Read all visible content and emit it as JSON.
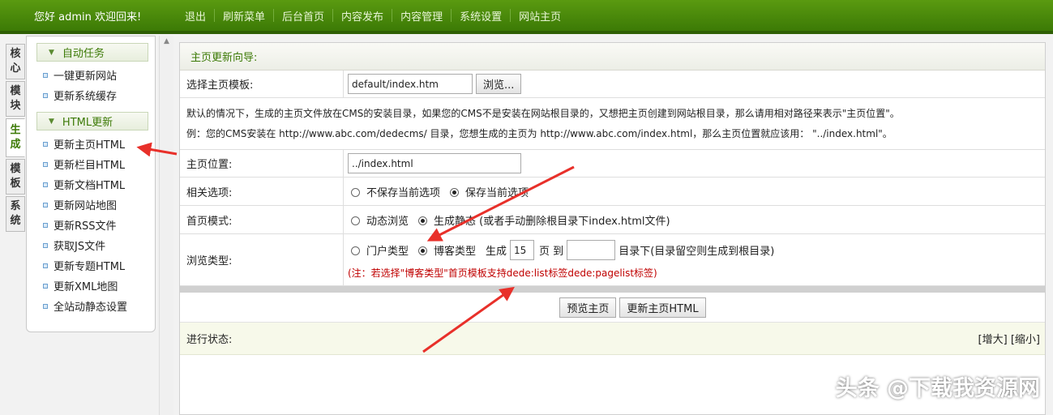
{
  "header": {
    "greeting": "您好 admin 欢迎回来!",
    "nav": [
      "退出",
      "刷新菜单",
      "后台首页",
      "内容发布",
      "内容管理",
      "系统设置",
      "网站主页"
    ]
  },
  "side_tabs": [
    "核心",
    "模块",
    "生成",
    "模板",
    "系统"
  ],
  "side_tab_active": "生成",
  "menu": {
    "group1": "自动任务",
    "group1_items": [
      "一键更新网站",
      "更新系统缓存"
    ],
    "group2": "HTML更新",
    "group2_items": [
      "更新主页HTML",
      "更新栏目HTML",
      "更新文档HTML",
      "更新网站地图",
      "更新RSS文件",
      "获取JS文件",
      "更新专题HTML",
      "更新XML地图",
      "全站动静态设置"
    ]
  },
  "form": {
    "title": "主页更新向导:",
    "template_label": "选择主页模板:",
    "template_value": "default/index.htm",
    "browse_label": "浏览...",
    "info_line1": "默认的情况下，生成的主页文件放在CMS的安装目录，如果您的CMS不是安装在网站根目录的，又想把主页创建到网站根目录，那么请用相对路径来表示\"主页位置\"。",
    "info_line2": "例：您的CMS安装在 http://www.abc.com/dedecms/ 目录，您想生成的主页为 http://www.abc.com/index.html，那么主页位置就应该用： \"../index.html\"。",
    "position_label": "主页位置:",
    "position_value": "../index.html",
    "related_label": "相关选项:",
    "related_opt1": "不保存当前选项",
    "related_opt2": "保存当前选项",
    "mode_label": "首页模式:",
    "mode_opt1": "动态浏览",
    "mode_opt2": "生成静态 (或者手动删除根目录下index.html文件)",
    "browse_type_label": "浏览类型:",
    "type_opt1": "门户类型",
    "type_opt2": "博客类型",
    "generate_label": "生成",
    "pages_value": "15",
    "pages_to": "页 到",
    "dir_value": "",
    "dir_suffix": "目录下(目录留空则生成到根目录)",
    "note": "(注：若选择\"博客类型\"首页模板支持dede:list标签dede:pagelist标签)",
    "preview_btn": "预览主页",
    "update_btn": "更新主页HTML",
    "status_label": "进行状态:",
    "enlarge": "[增大]",
    "shrink": "[缩小]"
  },
  "watermark": "头条 @下载我资源网",
  "colors": {
    "header_green": "#3c7a06",
    "arrow_red": "#e8302a",
    "note_red": "#c00000"
  }
}
